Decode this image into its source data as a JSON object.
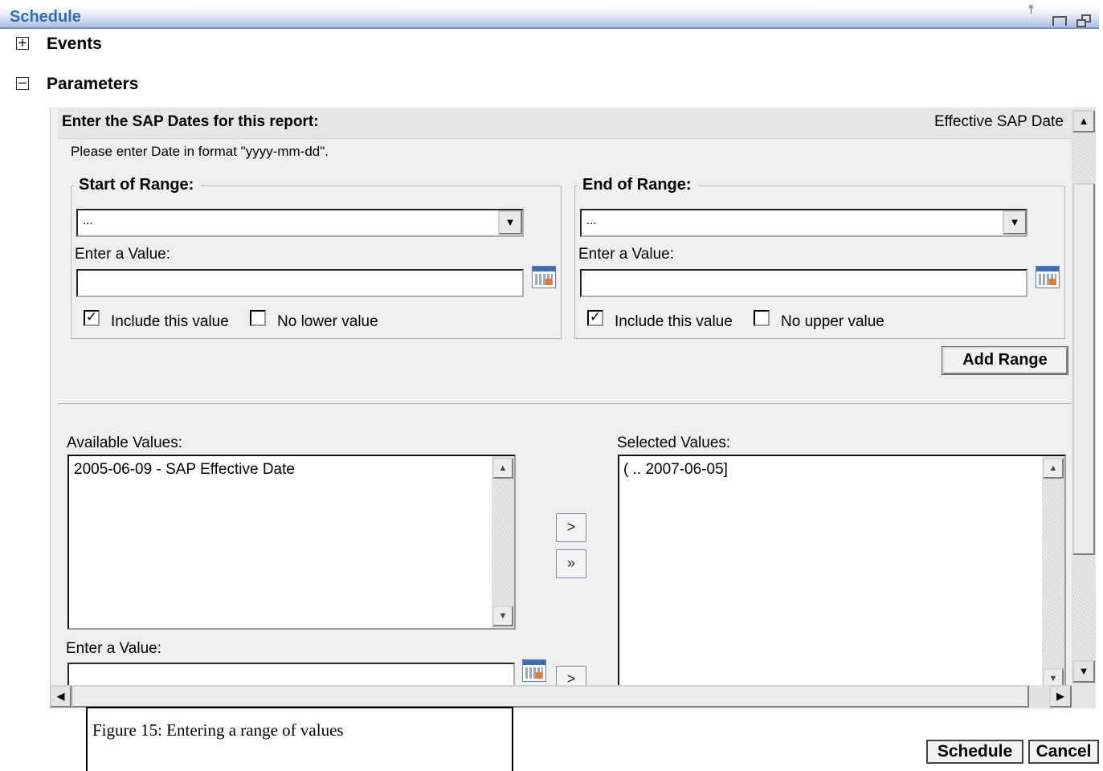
{
  "window": {
    "title": "Schedule"
  },
  "sections": {
    "events": {
      "label": "Events",
      "toggle": "+"
    },
    "parameters": {
      "label": "Parameters",
      "toggle": "−"
    }
  },
  "parameter": {
    "prompt": "Enter the SAP Dates for this report:",
    "name": "Effective SAP Date",
    "hint": "Please enter Date in format \"yyyy-mm-dd\".",
    "start": {
      "legend": "Start of Range:",
      "combo_value": "...",
      "enter_label": "Enter a Value:",
      "value": "",
      "include_label": "Include this value",
      "include_checked": true,
      "nobound_label": "No lower value",
      "nobound_checked": false
    },
    "end": {
      "legend": "End of Range:",
      "combo_value": "...",
      "enter_label": "Enter a Value:",
      "value": "",
      "include_label": "Include this value",
      "include_checked": true,
      "nobound_label": "No upper value",
      "nobound_checked": false
    },
    "add_range_label": "Add Range",
    "available_label": "Available Values:",
    "available_values": [
      "2005-06-09 - SAP Effective Date"
    ],
    "selected_label": "Selected Values:",
    "selected_values": [
      "( .. 2007-06-05]"
    ],
    "move_one": ">",
    "move_all": "»",
    "bottom_enter_label": "Enter a Value:",
    "bottom_value": ""
  },
  "caption": "Figure 15: Entering  a range of values",
  "footer": {
    "schedule_label": "Schedule",
    "cancel_label": "Cancel"
  },
  "icons": [
    "pin-icon",
    "minimize-icon",
    "restore-icon",
    "calendar-icon",
    "scroll-up-icon",
    "scroll-down-icon",
    "scroll-left-icon",
    "scroll-right-icon"
  ]
}
